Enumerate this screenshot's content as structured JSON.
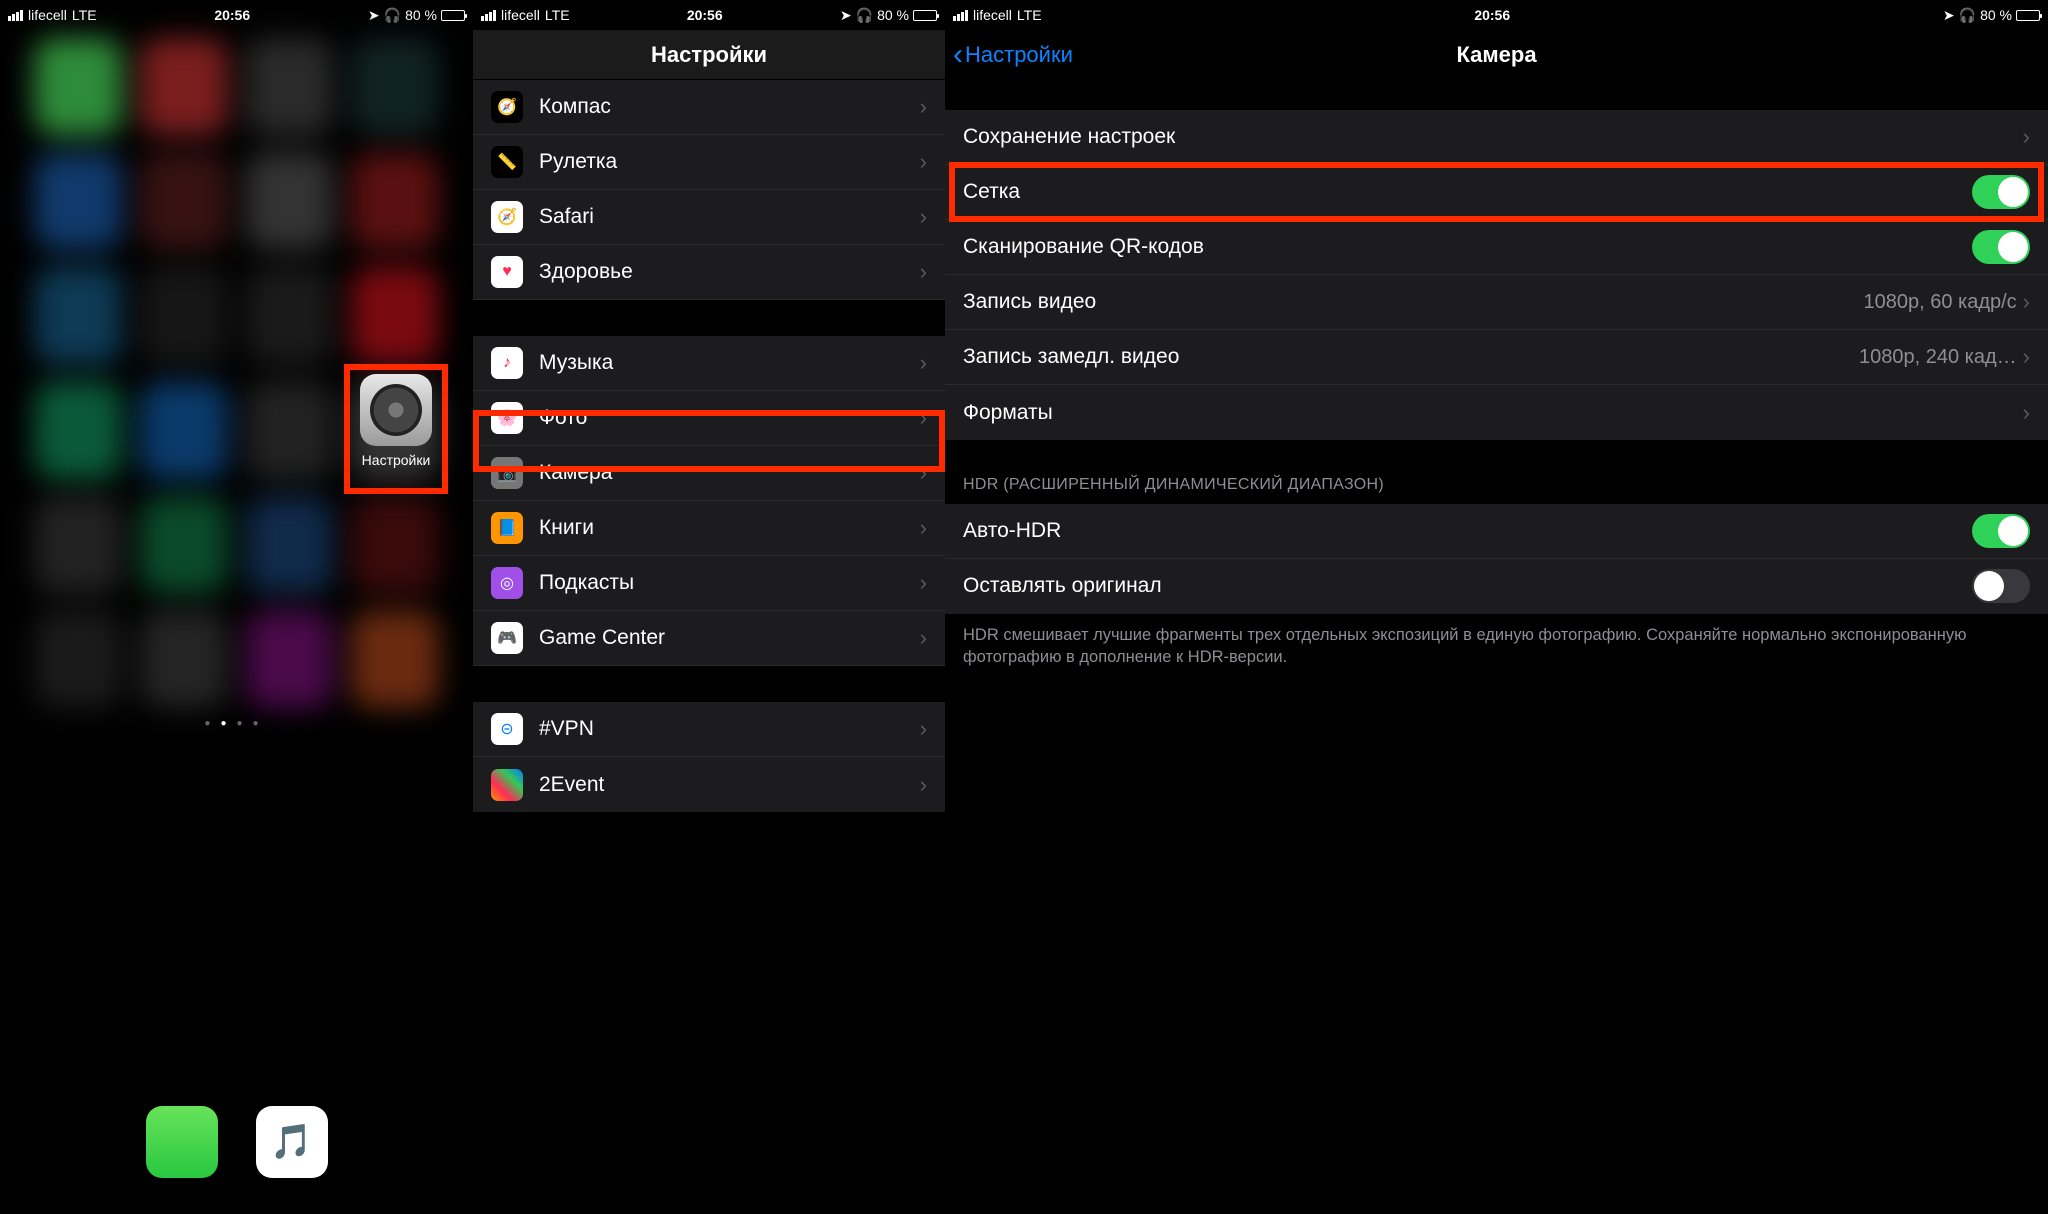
{
  "status": {
    "carrier": "lifecell",
    "net": "LTE",
    "time": "20:56",
    "battery": "80 %"
  },
  "home": {
    "settings_label": "Настройки"
  },
  "settings": {
    "title": "Настройки",
    "group1": [
      {
        "label": "Компас"
      },
      {
        "label": "Рулетка"
      },
      {
        "label": "Safari"
      },
      {
        "label": "Здоровье"
      }
    ],
    "group2": [
      {
        "label": "Музыка"
      },
      {
        "label": "Фото"
      },
      {
        "label": "Камера"
      },
      {
        "label": "Книги"
      },
      {
        "label": "Подкасты"
      },
      {
        "label": "Game Center"
      }
    ],
    "group3": [
      {
        "label": "#VPN"
      },
      {
        "label": "2Event"
      }
    ]
  },
  "camera": {
    "back": "Настройки",
    "title": "Камера",
    "rows": {
      "preserve": "Сохранение настроек",
      "grid": "Сетка",
      "qr": "Сканирование QR-кодов",
      "video": "Запись видео",
      "video_val": "1080p, 60 кадр/с",
      "slomo": "Запись замедл. видео",
      "slomo_val": "1080p, 240 кад…",
      "formats": "Форматы"
    },
    "hdr_header": "HDR (РАСШИРЕННЫЙ ДИНАМИЧЕСКИЙ ДИАПАЗОН)",
    "hdr": {
      "auto": "Авто-HDR",
      "keep": "Оставлять оригинал"
    },
    "hdr_footer": "HDR смешивает лучшие фрагменты трех отдельных экспозиций в единую фотографию. Сохраняйте нормально экспонированную фотографию в дополнение к HDR-версии."
  }
}
